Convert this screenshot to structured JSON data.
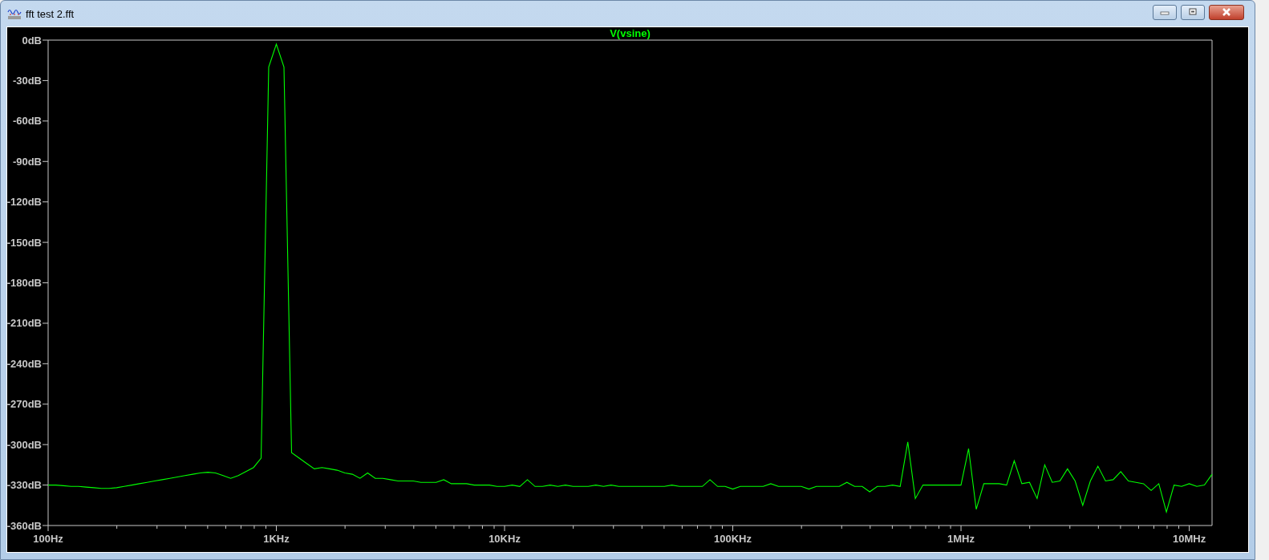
{
  "window": {
    "title": "fft test 2.fft",
    "controls": [
      {
        "kind": "minimize"
      },
      {
        "kind": "maximize"
      },
      {
        "kind": "close"
      }
    ]
  },
  "plot": {
    "chart_data": {
      "type": "line",
      "categories": [
        "100Hz",
        null,
        null,
        null,
        null,
        null,
        null,
        null,
        null,
        null,
        null,
        null,
        null,
        null,
        null,
        null,
        null,
        null,
        null,
        null,
        null,
        null,
        null,
        null,
        null,
        null,
        null,
        null,
        null,
        null,
        "1KHz",
        null,
        null,
        null,
        null,
        null,
        null,
        null,
        null,
        null,
        null,
        null,
        null,
        null,
        null,
        null,
        null,
        null,
        null,
        null,
        null,
        null,
        null,
        null,
        null,
        null,
        null,
        null,
        null,
        null,
        "10KHz",
        null,
        null,
        null,
        null,
        null,
        null,
        null,
        null,
        null,
        null,
        null,
        null,
        null,
        null,
        null,
        null,
        null,
        null,
        null,
        null,
        null,
        null,
        null,
        null,
        null,
        null,
        null,
        null,
        null,
        "100KHz",
        null,
        null,
        null,
        null,
        null,
        null,
        null,
        null,
        null,
        null,
        null,
        null,
        null,
        null,
        null,
        null,
        null,
        null,
        null,
        null,
        null,
        null,
        null,
        null,
        null,
        null,
        null,
        null,
        null,
        "1MHz",
        null,
        null,
        null,
        null,
        null,
        null,
        null,
        null,
        null,
        null,
        null,
        null,
        null,
        null,
        null,
        null,
        null,
        null,
        null,
        null,
        null,
        null,
        null,
        null,
        null,
        null,
        null,
        null,
        null,
        "10MHz",
        null,
        null,
        null
      ],
      "series": [
        {
          "name": "V(vsine)",
          "color": "#00ff00",
          "values": [
            -330,
            -330,
            -330.5,
            -331,
            -331,
            -331.5,
            -332,
            -332.5,
            -332.5,
            -332,
            -331,
            -330,
            -329,
            -328,
            -327,
            -326,
            -325,
            -324,
            -323,
            -322,
            -321,
            -320.5,
            -321,
            -323,
            -325,
            -323,
            -320,
            -317,
            -310,
            -20,
            -3,
            -20,
            -306,
            -310,
            -314,
            -318,
            -317,
            -318,
            -319,
            -321,
            -322,
            -325,
            -321,
            -325,
            -325,
            -326,
            -327,
            -327,
            -327,
            -328,
            -328,
            -328,
            -326,
            -329,
            -329,
            -329,
            -330,
            -330,
            -330,
            -331,
            -331,
            -330,
            -331,
            -326,
            -331,
            -331,
            -330,
            -331,
            -330,
            -331,
            -331,
            -331,
            -330,
            -331,
            -330,
            -331,
            -331,
            -331,
            -331,
            -331,
            -331,
            -331,
            -330,
            -331,
            -331,
            -331,
            -331,
            -326,
            -331,
            -331,
            -333,
            -331,
            -331,
            -331,
            -331,
            -329,
            -331,
            -331,
            -331,
            -331,
            -333,
            -331,
            -331,
            -331,
            -331,
            -328,
            -331,
            -331,
            -335,
            -331,
            -331,
            -330,
            -331,
            -298,
            -340,
            -330,
            -330,
            -330,
            -330,
            -330,
            -330,
            -303,
            -348,
            -329,
            -329,
            -329,
            -330,
            -312,
            -329,
            -328,
            -340,
            -315,
            -328,
            -327,
            -318,
            -327,
            -345,
            -327,
            -316,
            -327,
            -326,
            -320,
            -327,
            -328,
            -329,
            -334,
            -329,
            -350,
            -330,
            -331,
            -329,
            -331,
            -330,
            -322
          ]
        }
      ],
      "ylim": [
        -360,
        0
      ],
      "yticks": [
        {
          "value": 0,
          "label": "0dB"
        },
        {
          "value": -30,
          "label": "-30dB"
        },
        {
          "value": -60,
          "label": "-60dB"
        },
        {
          "value": -90,
          "label": "-90dB"
        },
        {
          "value": -120,
          "label": "-120dB"
        },
        {
          "value": -150,
          "label": "-150dB"
        },
        {
          "value": -180,
          "label": "-180dB"
        },
        {
          "value": -210,
          "label": "-210dB"
        },
        {
          "value": -240,
          "label": "-240dB"
        },
        {
          "value": -270,
          "label": "-270dB"
        },
        {
          "value": -300,
          "label": "-300dB"
        },
        {
          "value": -330,
          "label": "-330dB"
        },
        {
          "value": -360,
          "label": "-360dB"
        }
      ]
    }
  }
}
